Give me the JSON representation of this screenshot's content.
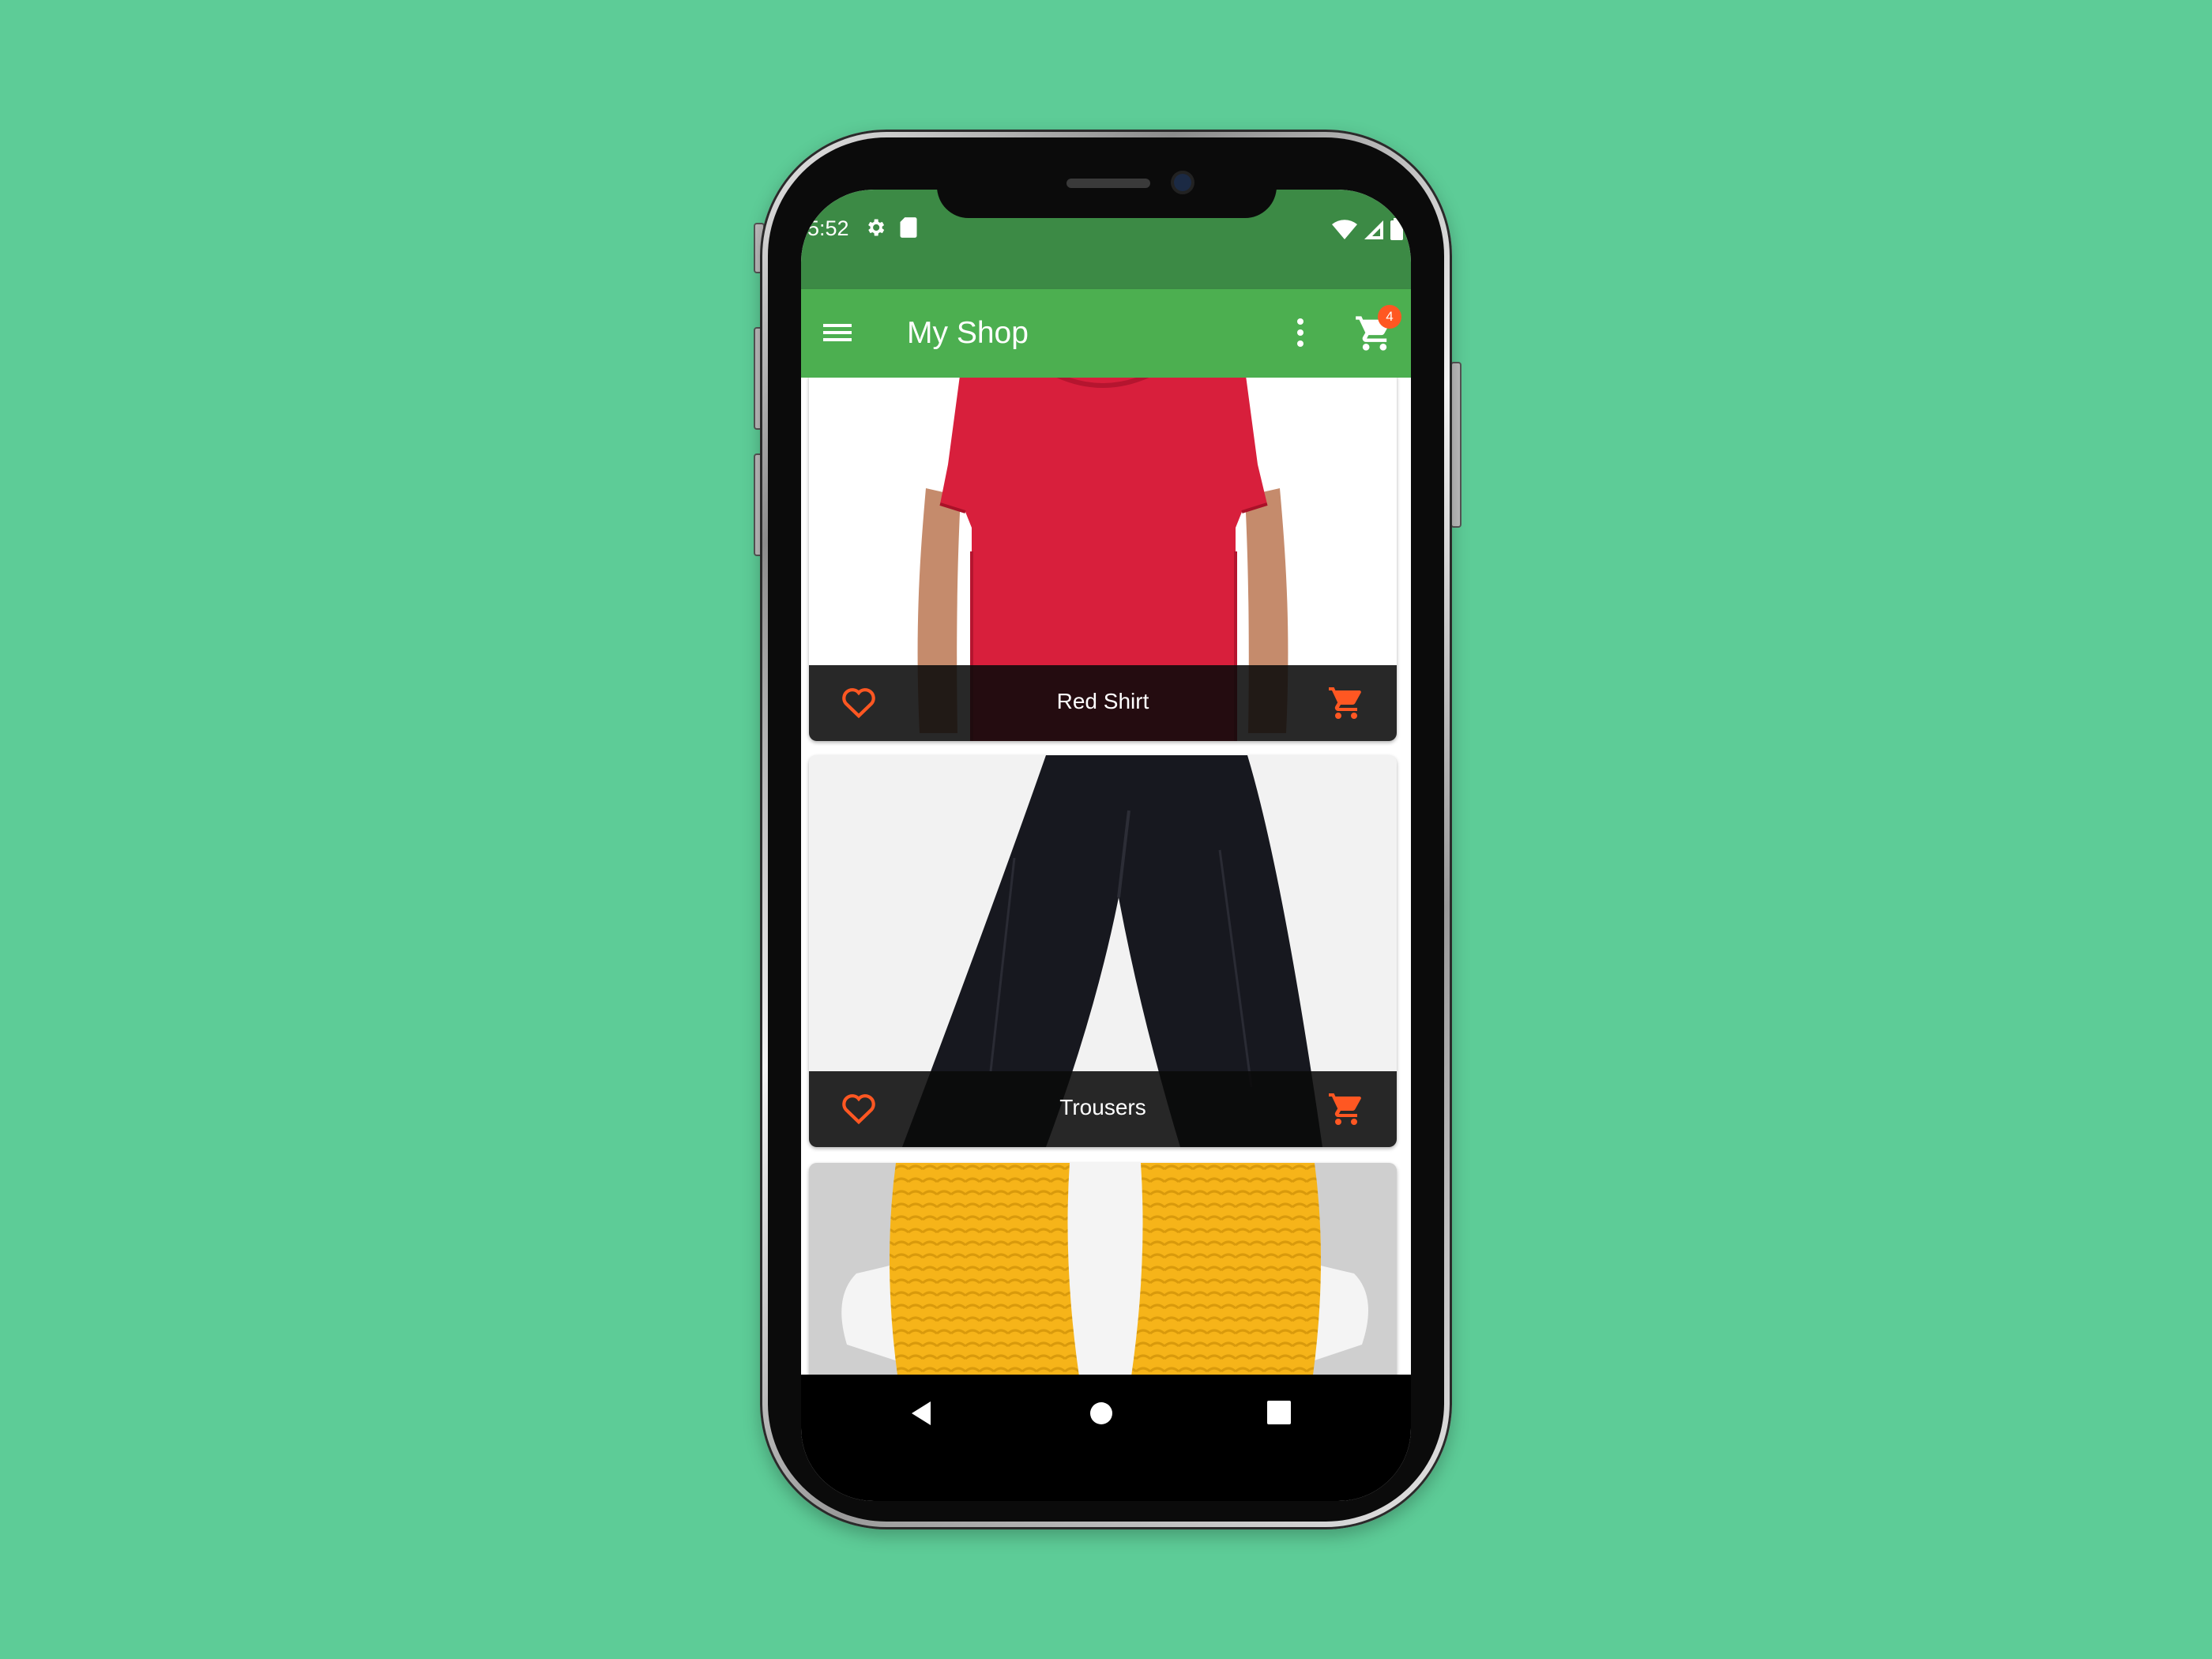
{
  "status_bar": {
    "time": "5:52",
    "left_icons": [
      "settings-icon",
      "sd-card-icon"
    ],
    "right_icons": [
      "wifi-icon",
      "signal-icon",
      "battery-icon"
    ]
  },
  "app_bar": {
    "title": "My Shop",
    "cart_badge": "4",
    "color": "#4caf50",
    "status_color": "#3c8a45"
  },
  "products": [
    {
      "name": "Red Shirt",
      "image": "red-shirt-image"
    },
    {
      "name": "Trousers",
      "image": "trousers-image"
    },
    {
      "name": "",
      "image": "yellow-scarf-image"
    }
  ],
  "accent_color": "#ff5722",
  "background_color": "#5dcc97"
}
